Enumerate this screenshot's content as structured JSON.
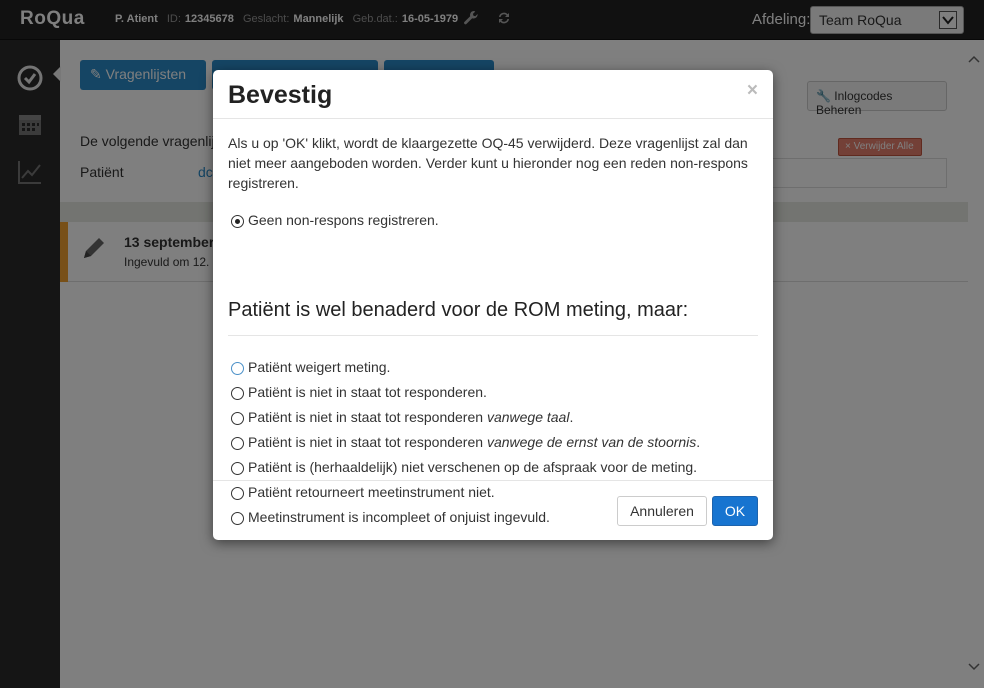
{
  "topbar": {
    "brand": "RoQua",
    "patient_name": "P. Atient",
    "id_label": "ID:",
    "id_value": "12345678",
    "gender_label": "Geslacht:",
    "gender_value": "Mannelijk",
    "dob_label": "Geb.dat.:",
    "dob_value": "16-05-1979",
    "department_label": "Afdeling:",
    "department_value": "Team RoQua"
  },
  "main": {
    "questionnaires_button": "Vragenlijsten",
    "login_codes_button": "Inlogcodes Beheren",
    "intro_text": "De volgende vragenlij",
    "patient_label": "Patiënt",
    "patient_link": "dc",
    "delete_all_button": "Verwijder Alle",
    "row_date": "13 september",
    "row_subtitle": "Ingevuld om 12."
  },
  "modal": {
    "title": "Bevestig",
    "close": "×",
    "intro": "Als u op 'OK' klikt, wordt de klaargezette OQ-45 verwijderd. Deze vragenlijst zal dan niet meer aangeboden worden. Verder kunt u hieronder nog een reden non-respons registreren.",
    "no_response_option": "Geen non-respons registreren.",
    "section_heading": "Patiënt is wel benaderd voor de ROM meting, maar:",
    "options": [
      {
        "text": "Patiënt weigert meting.",
        "em": ""
      },
      {
        "text": "Patiënt is niet in staat tot responderen.",
        "em": ""
      },
      {
        "text": "Patiënt is niet in staat tot responderen ",
        "em": "vanwege taal",
        "tail": "."
      },
      {
        "text": "Patiënt is niet in staat tot responderen ",
        "em": "vanwege de ernst van de stoornis",
        "tail": "."
      },
      {
        "text": "Patiënt is (herhaaldelijk) niet verschenen op de afspraak voor de meting.",
        "em": ""
      },
      {
        "text": "Patiënt retourneert meetinstrument niet.",
        "em": ""
      },
      {
        "text": "Meetinstrument is incompleet of onjuist ingevuld.",
        "em": ""
      }
    ],
    "cancel_button": "Annuleren",
    "ok_button": "OK"
  },
  "colors": {
    "primary": "#1774d0",
    "accent_orange": "#f0a030",
    "danger": "#e7806f"
  },
  "icons": [
    "wrench-icon",
    "refresh-icon",
    "dashboard-icon",
    "calendar-icon",
    "chart-icon",
    "pencil-icon",
    "close-icon"
  ]
}
